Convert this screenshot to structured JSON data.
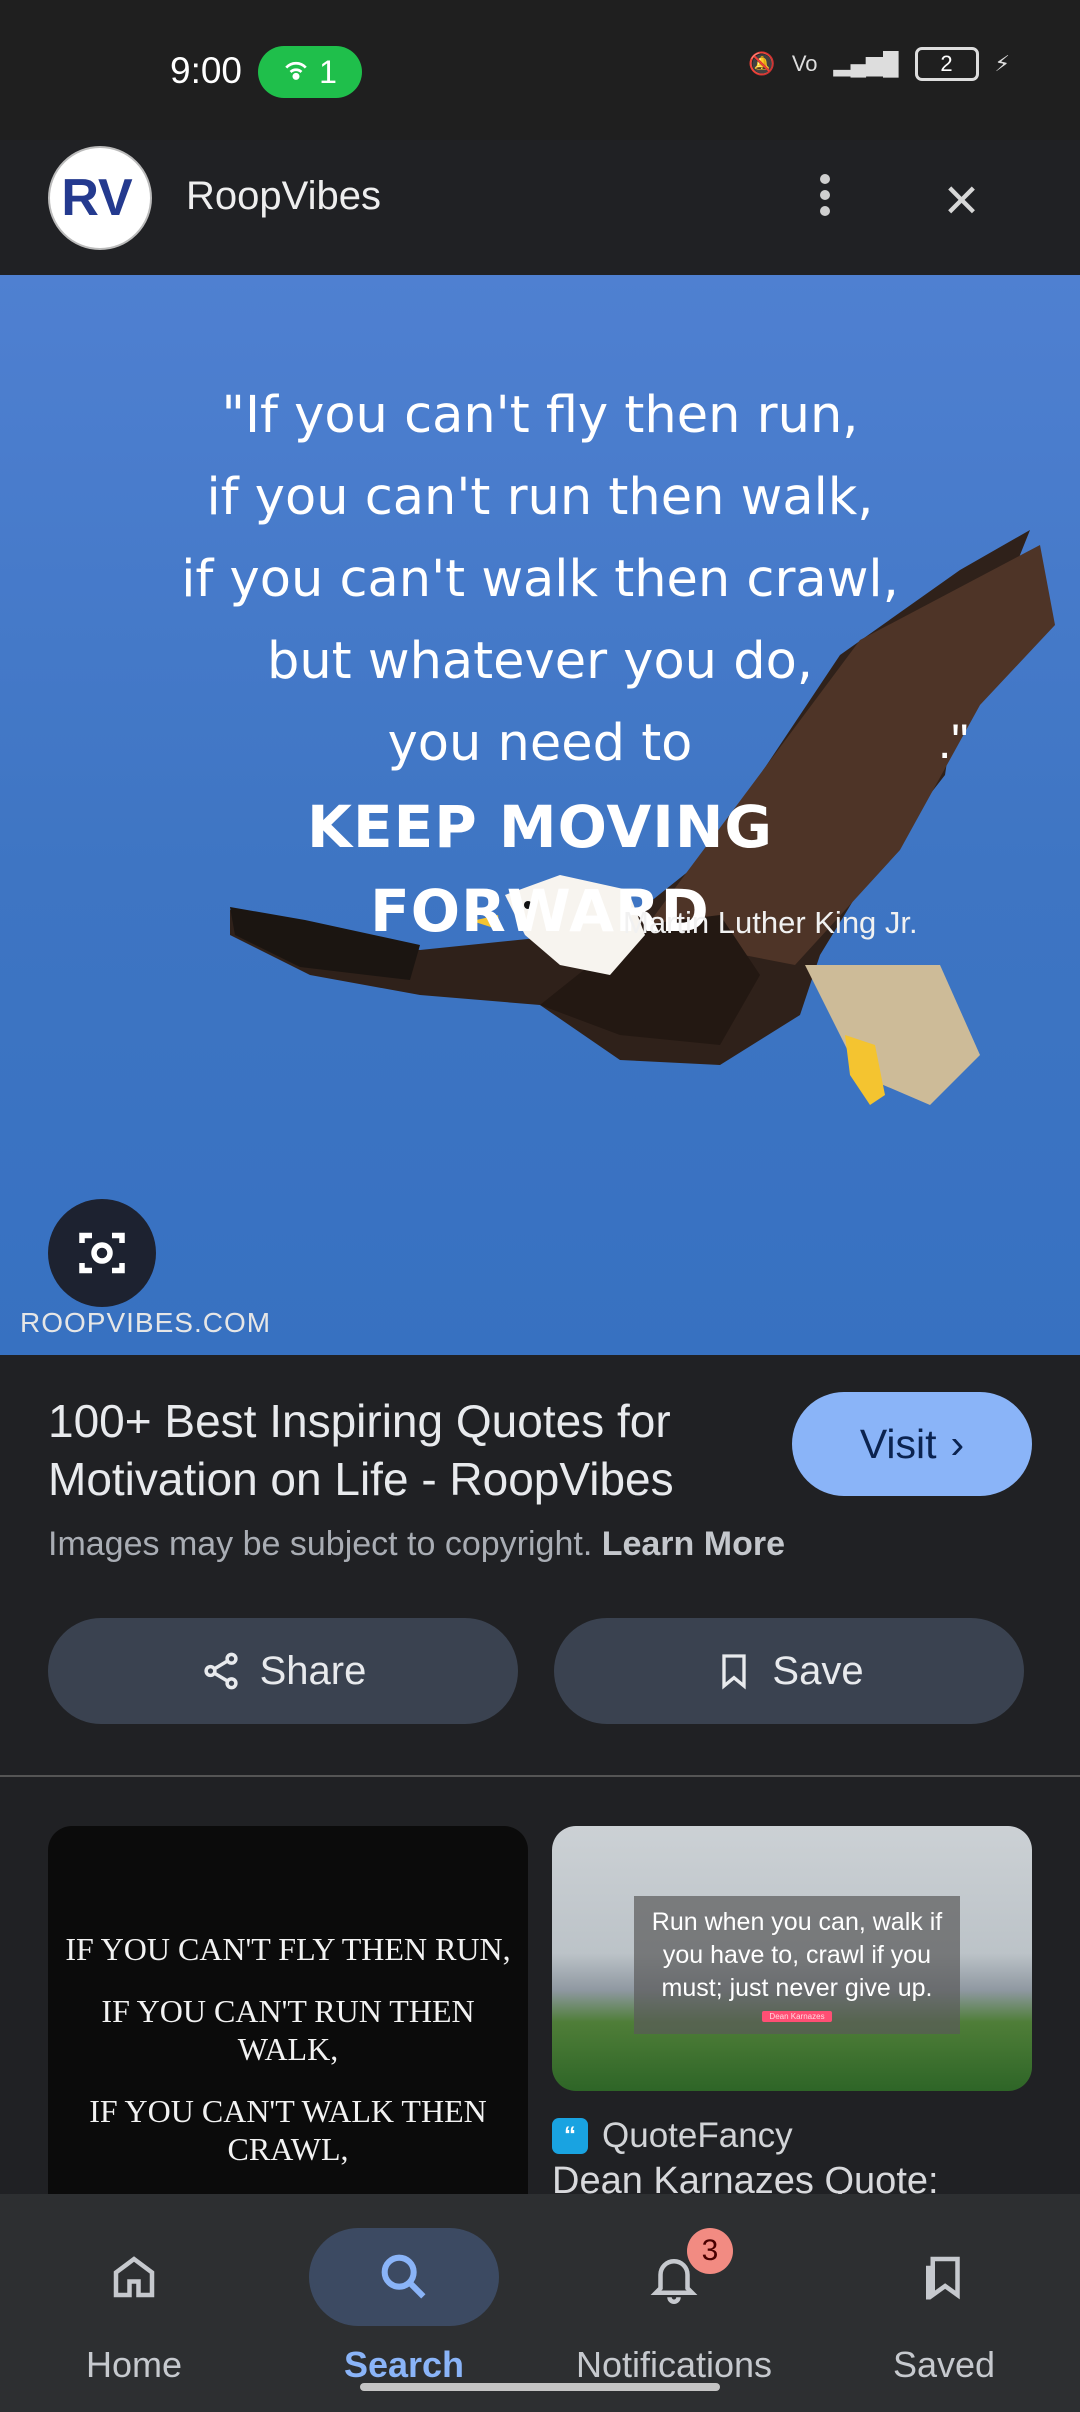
{
  "status_bar": {
    "time": "9:00",
    "hotspot_count": "1",
    "battery_level": "2"
  },
  "header": {
    "site_logo_text": "RV",
    "site_name": "RoopVibes"
  },
  "image": {
    "quote_lines": [
      "\"If you can't fly then run,",
      "if you can't run then walk,",
      "if you can't walk then crawl,",
      "but whatever you do,",
      "you need to"
    ],
    "quote_emphasis": "KEEP MOVING FORWARD",
    "author": "Martin Luther King Jr.",
    "watermark": "ROOPVIBES.COM",
    "closing_quote": ".\""
  },
  "result": {
    "title": "100+ Best Inspiring Quotes for Motivation on Life - RoopVibes",
    "copyright_text": "Images may be subject to copyright.",
    "learn_more_label": "Learn More",
    "visit_label": "Visit"
  },
  "actions": {
    "share_label": "Share",
    "save_label": "Save"
  },
  "related": {
    "card1_lines": [
      "IF YOU CAN'T FLY THEN RUN,",
      "IF YOU CAN'T RUN THEN",
      "WALK,",
      "IF YOU CAN'T WALK THEN",
      "CRAWL,"
    ],
    "card2_overlay_text": "Run when you can, walk if you have to, crawl if you must; just never give up.",
    "card2_tag": "Dean Karnazes",
    "source_icon": "quote-icon",
    "source_name": "QuoteFancy",
    "snippet": "Dean Karnazes Quote:"
  },
  "bottom_nav": {
    "items": [
      {
        "label": "Home",
        "icon": "home-icon"
      },
      {
        "label": "Search",
        "icon": "search-icon"
      },
      {
        "label": "Notifications",
        "icon": "bell-icon"
      },
      {
        "label": "Saved",
        "icon": "saved-icon"
      }
    ],
    "notification_count": "3"
  },
  "colors": {
    "background": "#202124",
    "hero_blue": "#3e75c3",
    "visit_button": "#8ab4f8",
    "pill_button": "#3a4250",
    "accent_text": "#8ab4f8"
  }
}
